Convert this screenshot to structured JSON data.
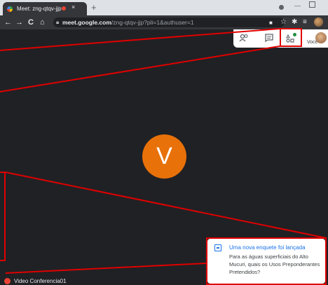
{
  "browser": {
    "tab": {
      "title": "Meet: zng-qtqv-jjp",
      "close_glyph": "×"
    },
    "new_tab_glyph": "+",
    "nav": {
      "back": "←",
      "forward": "→",
      "reload": "C",
      "home": "⌂"
    },
    "url": {
      "host": "meet.google.com",
      "path": "/zng-qtqv-jjp?pli=1&authuser=1"
    },
    "window_min_glyph": "—"
  },
  "meet": {
    "controls": {
      "participants_icon": "people-icon",
      "chat_icon": "chat-icon",
      "activities_icon": "activities-icon",
      "you_label": "Você"
    },
    "participant": {
      "initial": "V",
      "color": "#e8710a"
    },
    "poll_notification": {
      "title": "Uma nova enquete foi lançada",
      "body": "Para as águas superficiais do Alto Mucuri, quais os Usos Preponderantes Pretendidos?"
    },
    "meeting_name": "Video Conferencia01"
  },
  "colors": {
    "annotation": "#e00000",
    "accent": "#1a73e8",
    "background": "#202124"
  }
}
